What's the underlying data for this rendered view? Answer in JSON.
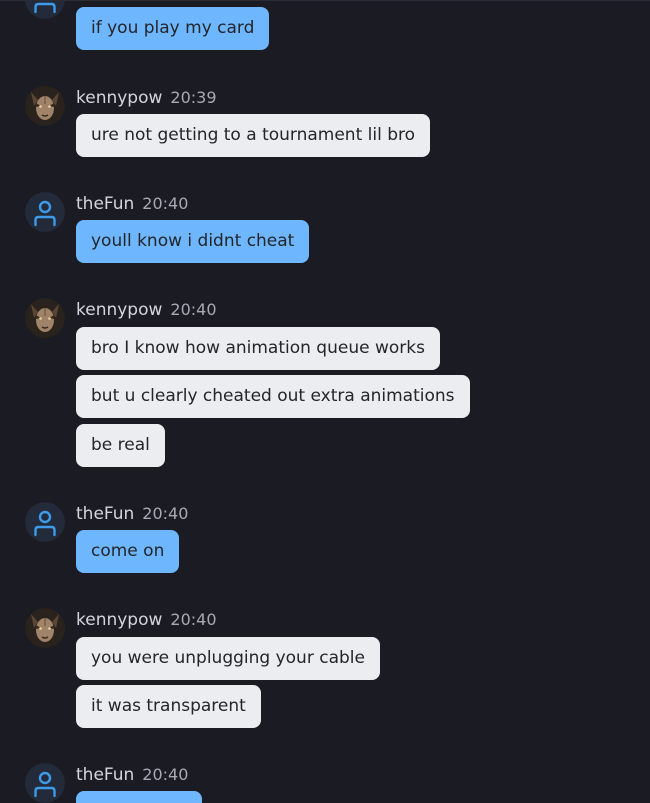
{
  "colors": {
    "background": "#1b1c23",
    "self_bubble": "#6eb6fd",
    "other_bubble": "#ecedf0",
    "self_avatar_icon": "#3d9be9"
  },
  "messages": [
    {
      "text": "if you play my card"
    },
    {
      "username": "kennypow",
      "time": "20:39",
      "text": "ure not getting to a tournament lil bro"
    },
    {
      "username": "theFun",
      "time": "20:40",
      "text": "youll know i didnt cheat"
    },
    {
      "username": "kennypow",
      "time": "20:40",
      "lines": [
        "bro I know how animation queue works",
        "but u clearly cheated out extra animations",
        "be real"
      ]
    },
    {
      "username": "theFun",
      "time": "20:40",
      "text": "come on"
    },
    {
      "username": "kennypow",
      "time": "20:40",
      "lines": [
        "you were unplugging your cable",
        "it was transparent"
      ]
    },
    {
      "username": "theFun",
      "time": "20:40"
    }
  ],
  "icons": {
    "self_avatar": "user-silhouette-icon",
    "other_avatar": "demon-face-icon"
  }
}
